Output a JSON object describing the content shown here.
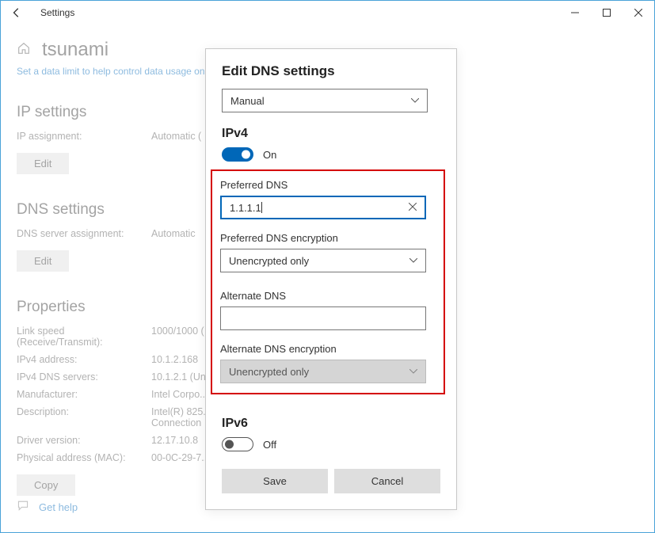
{
  "window": {
    "title": "Settings"
  },
  "page": {
    "name": "tsunami",
    "hint": "Set a data limit to help control data usage on ...",
    "help": "Get help"
  },
  "ip": {
    "heading": "IP settings",
    "assign_label": "IP assignment:",
    "assign_value": "Automatic (",
    "edit": "Edit"
  },
  "dns": {
    "heading": "DNS settings",
    "assign_label": "DNS server assignment:",
    "assign_value": "Automatic",
    "edit": "Edit"
  },
  "props": {
    "heading": "Properties",
    "rows": [
      {
        "k": "Link speed (Receive/Transmit):",
        "v": "1000/1000 ("
      },
      {
        "k": "IPv4 address:",
        "v": "10.1.2.168"
      },
      {
        "k": "IPv4 DNS servers:",
        "v": "10.1.2.1 (Un..."
      },
      {
        "k": "Manufacturer:",
        "v": "Intel Corpo..."
      },
      {
        "k": "Description:",
        "v": "Intel(R) 825...\nConnection"
      },
      {
        "k": "Driver version:",
        "v": "12.17.10.8"
      },
      {
        "k": "Physical address (MAC):",
        "v": "00-0C-29-7..."
      }
    ],
    "copy": "Copy"
  },
  "modal": {
    "title": "Edit DNS settings",
    "mode": "Manual",
    "ipv4": {
      "heading": "IPv4",
      "toggle": "On",
      "pref_dns_label": "Preferred DNS",
      "pref_dns_value": "1.1.1.1",
      "pref_enc_label": "Preferred DNS encryption",
      "pref_enc_value": "Unencrypted only",
      "alt_dns_label": "Alternate DNS",
      "alt_dns_value": "",
      "alt_enc_label": "Alternate DNS encryption",
      "alt_enc_value": "Unencrypted only"
    },
    "ipv6": {
      "heading": "IPv6",
      "toggle": "Off"
    },
    "save": "Save",
    "cancel": "Cancel"
  }
}
